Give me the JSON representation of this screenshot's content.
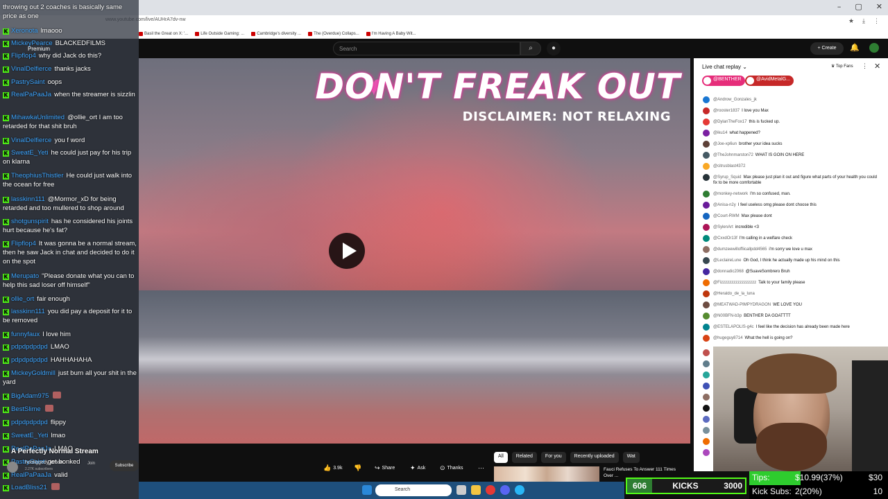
{
  "browser": {
    "url": "www.youtube.com/live/AUHrA7dv-nw",
    "bookmarks": [
      "Basil the Great on X: '...",
      "Life Outside Gaming: ...",
      "Cambridge's diversity ...",
      "The (Overdue) Collaps...",
      "I'm Having A Baby Wit..."
    ]
  },
  "youtube": {
    "logo_suffix": "Premium",
    "search_placeholder": "Search",
    "create_label": "Create"
  },
  "video": {
    "title_overlay": "DON'T FREAK OUT",
    "disclaimer": "DISCLAIMER: NOT RELAXING",
    "stream_title": "A Perfectly Normal Stream",
    "channel_name": "hotdiggedy.lemon",
    "channel_subs": "2.27K subscribers",
    "join_label": "Join",
    "subscribe_label": "Subscribe",
    "actions": {
      "likes": "3.9k",
      "share": "Share",
      "ask": "Ask",
      "thanks": "Thanks"
    }
  },
  "stream_chat": {
    "first_message": "throwing out 2 coaches is basically same price as one",
    "messages": [
      {
        "user": "Xeronota",
        "text": "lmaooo",
        "color": "blue"
      },
      {
        "user": "MickeyPearce",
        "text": "BLACKEDFILMS",
        "color": "blue"
      },
      {
        "user": "Flipflop4",
        "text": "why did Jack do this?",
        "color": "blue"
      },
      {
        "user": "VinalDelfierce",
        "text": "thanks jacks",
        "color": "blue"
      },
      {
        "user": "PastrySaint",
        "text": "oops",
        "color": "blue"
      },
      {
        "user": "RealPaPaaJa",
        "text": "when the streamer is sizzlin",
        "color": "blue"
      },
      {
        "user": "MihawkaUnlimited",
        "text": "@ollie_ort I am too retarded for that shit bruh",
        "color": "blue"
      },
      {
        "user": "VinalDelfierce",
        "text": "you f word",
        "color": "blue"
      },
      {
        "user": "SweatE_Yeti",
        "text": "he could just pay for his trip on klarna",
        "color": "blue"
      },
      {
        "user": "TheophiusThistler",
        "text": "He could just walk into the ocean for free",
        "color": "blue"
      },
      {
        "user": "lasskinn111",
        "text": "@Mormor_xD for being retarded and too mullered to shop around",
        "color": "blue"
      },
      {
        "user": "shotgunspirit",
        "text": "has he considered his joints hurt because he's fat?",
        "color": "blue"
      },
      {
        "user": "Flipflop4",
        "text": "It was gonna be a normal stream, then he saw Jack in chat and decided to do it on the spot",
        "color": "blue"
      },
      {
        "user": "Merupato",
        "text": "\"Please donate what you can to help this sad loser off himself\"",
        "color": "blue"
      },
      {
        "user": "ollie_ort",
        "text": "fair enough",
        "color": "blue"
      },
      {
        "user": "lasskinn111",
        "text": "you did pay a deposit for it to be removed",
        "color": "blue"
      },
      {
        "user": "funnyfaux",
        "text": "I love him",
        "color": "blue"
      },
      {
        "user": "pdpdpdpdpd",
        "text": "LMAO",
        "color": "blue"
      },
      {
        "user": "pdpdpdpdpd",
        "text": "HAHHAHAHA",
        "color": "blue"
      },
      {
        "user": "MickeyGoldmill",
        "text": "just burn all your shit in the yard",
        "color": "blue"
      },
      {
        "user": "BigAdam975",
        "text": "",
        "color": "blue"
      },
      {
        "user": "BestSlime",
        "text": "",
        "color": "blue"
      },
      {
        "user": "pdpdpdpdpd",
        "text": "flippy",
        "color": "blue"
      },
      {
        "user": "SweatE_Yeti",
        "text": "lmao",
        "color": "blue"
      },
      {
        "user": "RealPaPaaJa",
        "text": "LMAO",
        "color": "blue"
      },
      {
        "user": "PastrySaint",
        "text": "get bonked",
        "color": "blue"
      },
      {
        "user": "RealPaPaaJa",
        "text": "valid",
        "color": "blue"
      },
      {
        "user": "LoadBliss21",
        "text": "",
        "color": "blue"
      }
    ]
  },
  "live_chat": {
    "title": "Live chat replay",
    "top_fans": "Top Fans",
    "pinned": [
      "@BENTHER",
      "@AvidMetalG..."
    ],
    "messages": [
      {
        "user": "@Androw_Gonzales_jk",
        "text": ""
      },
      {
        "user": "@rooster1837",
        "text": "I love you Max"
      },
      {
        "user": "@DylanTheFox17",
        "text": "this is fucked up."
      },
      {
        "user": "@iku14",
        "text": "what happened?"
      },
      {
        "user": "@Joe-xp6un",
        "text": "brother your idea sucks"
      },
      {
        "user": "@TheJohnmarston72",
        "text": "WHAT IS GOIN ON HERE"
      },
      {
        "user": "@citrusblast4372",
        "text": ""
      },
      {
        "user": "@Syrup_Squid",
        "text": "Max please just plan it out and figure what parts of your health you could fix to be more comfortable"
      },
      {
        "user": "@monkey-network",
        "text": "I'm so confused, man."
      },
      {
        "user": "@Anisa-n2y",
        "text": "I feel useless omg please dont choose this"
      },
      {
        "user": "@Court-RWM",
        "text": "Max please dont"
      },
      {
        "user": "@SylenArt",
        "text": "incredible <3"
      },
      {
        "user": "@CxxdOr13f",
        "text": "I'm calling in a welfare check"
      },
      {
        "user": "@dumzeewilloffiicallpdd4565",
        "text": "i'm sorry   we love u max"
      },
      {
        "user": "@LeclaireLune",
        "text": "Oh God, I think he actually made up his mind on this"
      },
      {
        "user": "@donnadic2068",
        "text": "@SuaveSombrero Bruh"
      },
      {
        "user": "@Fizzzzzzzzzzzzzzzzz",
        "text": "Talk to your family please"
      },
      {
        "user": "@Heraldo_de_la_luna",
        "text": ""
      },
      {
        "user": "@MEATWAD-PIMPYDRAGON",
        "text": "WE LOVE YOU"
      },
      {
        "user": "@N00BFN-b3p",
        "text": "BENTHER DA GOATTTT"
      },
      {
        "user": "@ESTELAPOLIS-g4c",
        "text": "I feel like the decision has already been made here"
      },
      {
        "user": "@hugeguy8714",
        "text": "What the hell is going on?"
      }
    ]
  },
  "related": {
    "tabs": [
      "All",
      "Related",
      "For you",
      "Recently uploaded",
      "Wat"
    ],
    "first_title": "Fauci Refuses To Answer 111 Times Over ..."
  },
  "overlay": {
    "kicks_count": "606",
    "kicks_label": "KICKS",
    "kicks_goal": "3000",
    "tips_label": "Tips:",
    "tips_value": "$10.99(37%)",
    "tips_goal": "$30",
    "subs_label": "Kick Subs:",
    "subs_value": "2(20%)",
    "subs_goal": "10"
  },
  "taskbar": {
    "search_label": "Search"
  },
  "colors": {
    "kick_green": "#53fc18",
    "chat_user_blue": "#3ea6ff",
    "member_pink": "#e62d7a"
  }
}
